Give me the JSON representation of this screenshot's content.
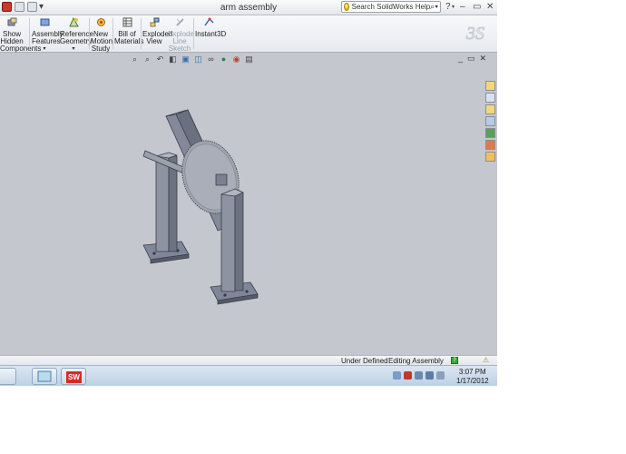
{
  "window": {
    "title": "arm assembly"
  },
  "search": {
    "label": "Search SolidWorks Help"
  },
  "ribbon": {
    "show_hidden": [
      "Show",
      "Hidden",
      "Components"
    ],
    "assembly_features": [
      "Assembly",
      "Features"
    ],
    "reference_geometry": [
      "Reference",
      "Geometry"
    ],
    "new_motion_study": [
      "New",
      "Motion",
      "Study"
    ],
    "bill_of_materials": [
      "Bill of",
      "Materials"
    ],
    "exploded_view": [
      "Exploded",
      "View"
    ],
    "explode_line_sketch": [
      "Explode",
      "Line",
      "Sketch"
    ],
    "instant3d": "Instant3D"
  },
  "viewbar": {
    "icons": [
      "zoom-to-fit-icon",
      "zoom-area-icon",
      "previous-view-icon",
      "section-view-icon",
      "view-orientation-icon",
      "display-style-icon",
      "hide-show-icon",
      "edit-appearance-icon",
      "apply-scene-icon",
      "view-settings-icon"
    ]
  },
  "statusbar": {
    "state": "Under Defined",
    "mode": "Editing Assembly"
  },
  "taskbar": {
    "time": "3:07 PM",
    "date": "1/17/2012"
  },
  "colors": {
    "viewport": "#c4c7cd",
    "steel": "#7d8391",
    "accent": "#d52c25"
  }
}
